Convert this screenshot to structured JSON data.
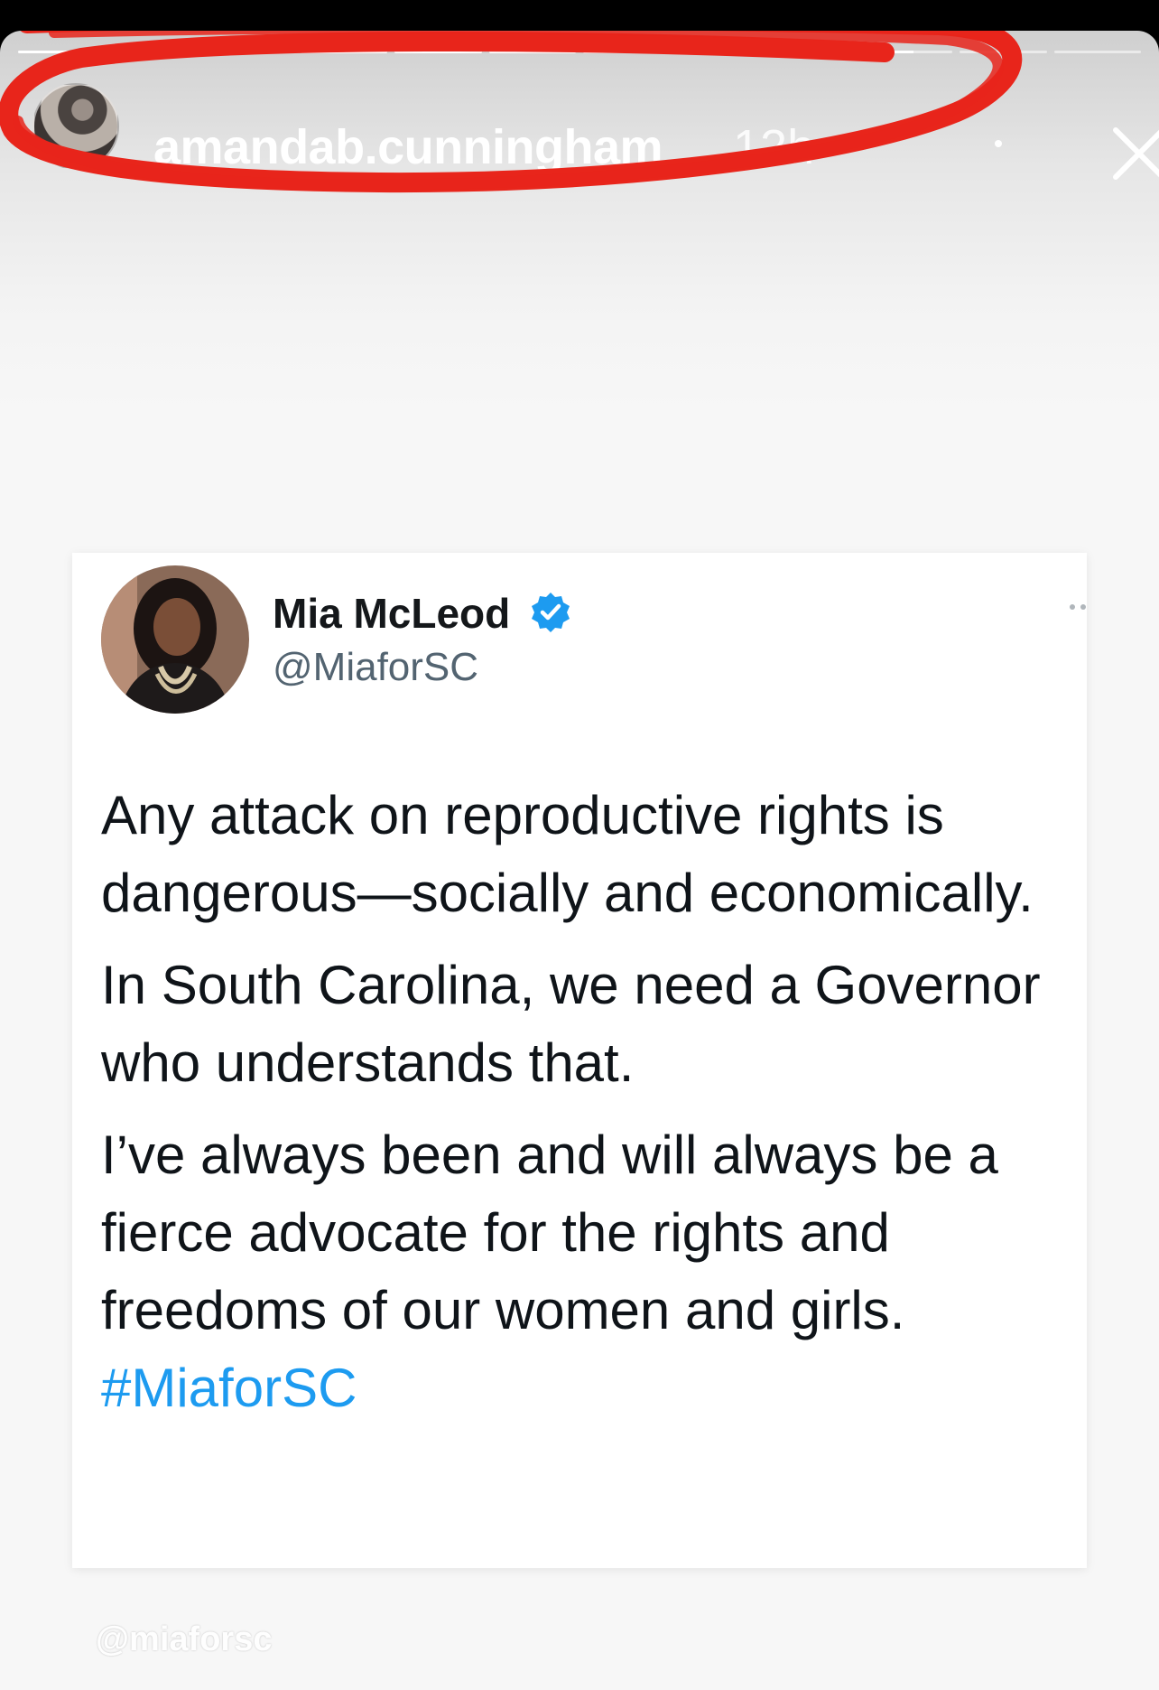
{
  "story": {
    "segments": [
      1,
      1,
      1,
      1,
      1,
      1,
      1,
      1,
      1,
      0.55,
      0,
      0
    ],
    "username": "amandab.cunningham",
    "time_ago": "12h",
    "menu_icon": "more-dots-icon",
    "close_icon": "close-icon",
    "annotation_color": "#e8251b"
  },
  "tweet": {
    "name": "Mia McLeod",
    "handle": "@MiaforSC",
    "verified_color": "#1d9bf0",
    "paragraphs": [
      "Any attack on reproductive rights is dangerous—socially and economically.",
      "In South Carolina, we need a Governor who understands that.",
      "I’ve always been and will always be a fierce advocate for the rights and freedoms of our women and girls."
    ],
    "hashtag": "#MiaforSC"
  },
  "watermark": "@miaforsc"
}
